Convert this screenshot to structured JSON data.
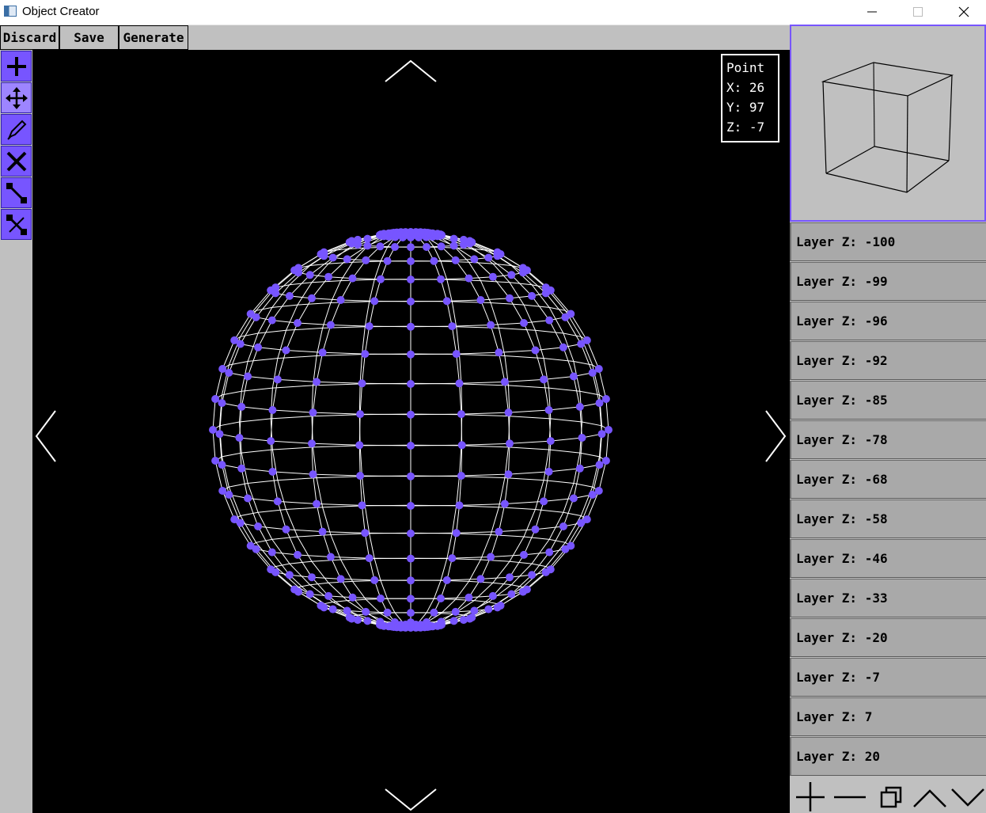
{
  "window": {
    "title": "Object Creator"
  },
  "menu": {
    "discard": "Discard",
    "save": "Save",
    "generate": "Generate"
  },
  "tools": [
    {
      "name": "add-point",
      "icon": "plus-icon"
    },
    {
      "name": "move",
      "icon": "move-arrows-icon"
    },
    {
      "name": "draw",
      "icon": "pencil-icon"
    },
    {
      "name": "delete",
      "icon": "x-icon"
    },
    {
      "name": "connect",
      "icon": "connect-line-icon"
    },
    {
      "name": "disconnect",
      "icon": "disconnect-line-icon"
    }
  ],
  "point_info": {
    "title": "Point",
    "x": "X: 26",
    "y": "Y: 97",
    "z": "Z: -7"
  },
  "layers": [
    "Layer Z: -100",
    "Layer Z: -99",
    "Layer Z: -96",
    "Layer Z: -92",
    "Layer Z: -85",
    "Layer Z: -78",
    "Layer Z: -68",
    "Layer Z: -58",
    "Layer Z: -46",
    "Layer Z: -33",
    "Layer Z: -20",
    "Layer Z: -7",
    "Layer Z: 7",
    "Layer Z: 20"
  ],
  "layer_controls": [
    "plus-icon",
    "minus-icon",
    "duplicate-icon",
    "chevron-up-icon",
    "chevron-down-icon"
  ],
  "colors": {
    "accent": "#7755ff",
    "wire": "#ffffff",
    "background": "#000000",
    "panel": "#c0c0c0"
  }
}
